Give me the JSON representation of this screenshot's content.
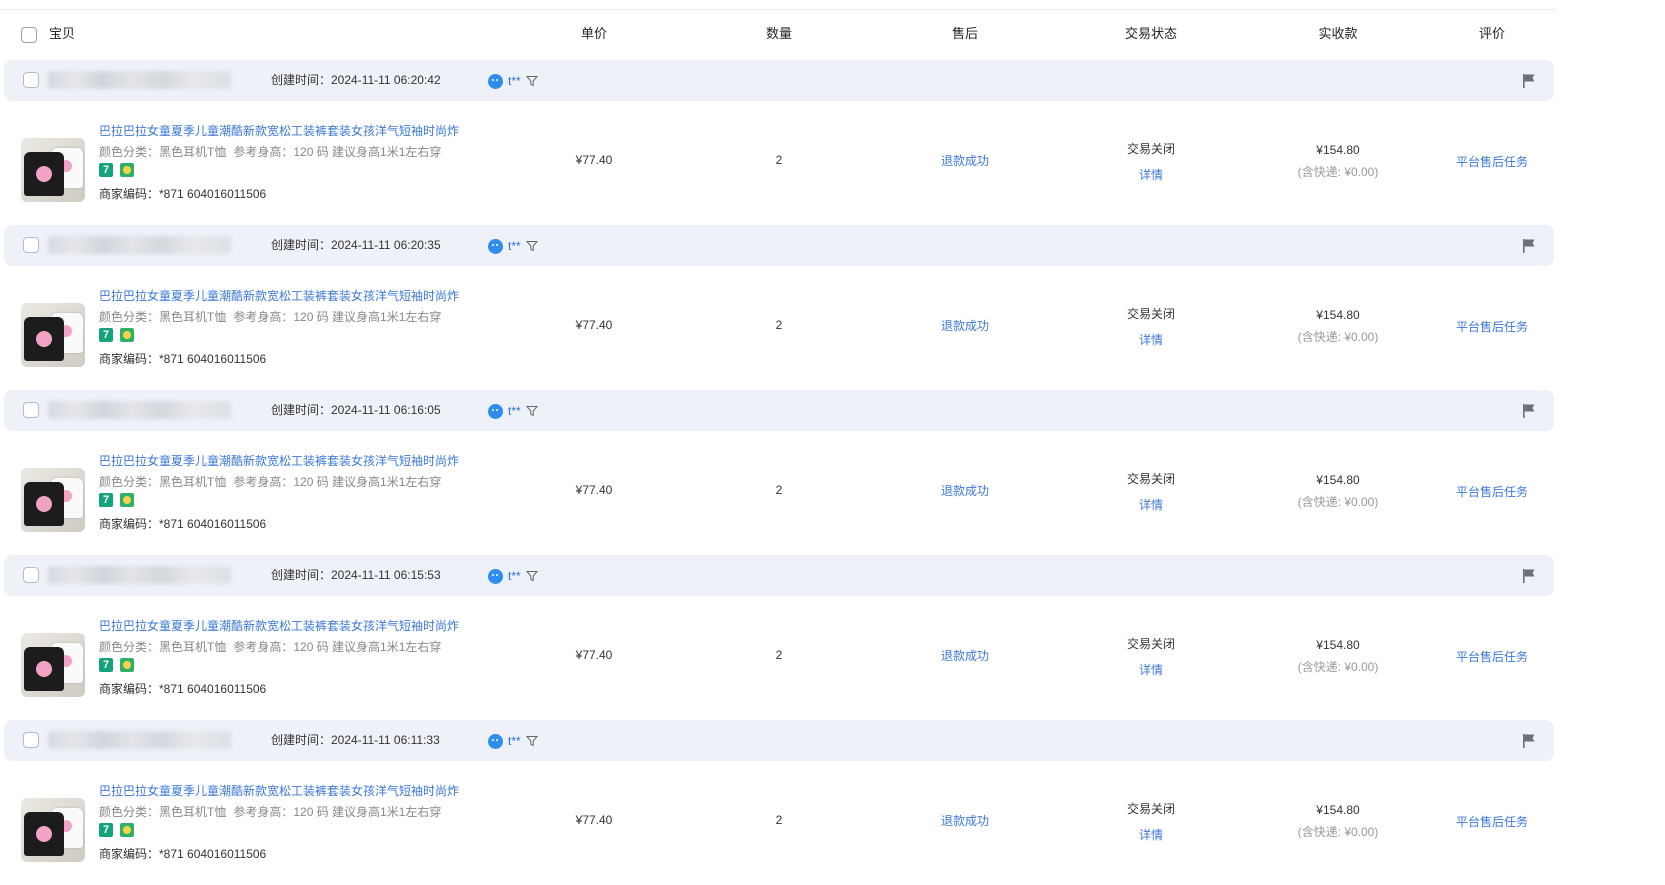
{
  "header": {
    "baobei": "宝贝",
    "price": "单价",
    "qty": "数量",
    "aftersale": "售后",
    "status": "交易状态",
    "amount": "实收款",
    "review": "评价"
  },
  "orders": [
    {
      "created": "创建时间：2024-11-11 06:20:42",
      "buyer": "t**",
      "title": "巴拉巴拉女童夏季儿童潮酷新款宽松工装裤套装女孩洋气短袖时尚炸",
      "spec_color": "颜色分类：黑色耳机T恤",
      "spec_size": "参考身高：120 码 建议身高1米1左右穿",
      "badge_text": "7",
      "code": "商家编码：*871 604016011506",
      "price": "¥77.40",
      "qty": "2",
      "aftersale": "退款成功",
      "status": "交易关闭",
      "detail": "详情",
      "amount": "¥154.80",
      "shipping": "(含快递: ¥0.00)",
      "review": "平台售后任务"
    },
    {
      "created": "创建时间：2024-11-11 06:20:35",
      "buyer": "t**",
      "title": "巴拉巴拉女童夏季儿童潮酷新款宽松工装裤套装女孩洋气短袖时尚炸",
      "spec_color": "颜色分类：黑色耳机T恤",
      "spec_size": "参考身高：120 码 建议身高1米1左右穿",
      "badge_text": "7",
      "code": "商家编码：*871 604016011506",
      "price": "¥77.40",
      "qty": "2",
      "aftersale": "退款成功",
      "status": "交易关闭",
      "detail": "详情",
      "amount": "¥154.80",
      "shipping": "(含快递: ¥0.00)",
      "review": "平台售后任务"
    },
    {
      "created": "创建时间：2024-11-11 06:16:05",
      "buyer": "t**",
      "title": "巴拉巴拉女童夏季儿童潮酷新款宽松工装裤套装女孩洋气短袖时尚炸",
      "spec_color": "颜色分类：黑色耳机T恤",
      "spec_size": "参考身高：120 码 建议身高1米1左右穿",
      "badge_text": "7",
      "code": "商家编码：*871 604016011506",
      "price": "¥77.40",
      "qty": "2",
      "aftersale": "退款成功",
      "status": "交易关闭",
      "detail": "详情",
      "amount": "¥154.80",
      "shipping": "(含快递: ¥0.00)",
      "review": "平台售后任务"
    },
    {
      "created": "创建时间：2024-11-11 06:15:53",
      "buyer": "t**",
      "title": "巴拉巴拉女童夏季儿童潮酷新款宽松工装裤套装女孩洋气短袖时尚炸",
      "spec_color": "颜色分类：黑色耳机T恤",
      "spec_size": "参考身高：120 码 建议身高1米1左右穿",
      "badge_text": "7",
      "code": "商家编码：*871 604016011506",
      "price": "¥77.40",
      "qty": "2",
      "aftersale": "退款成功",
      "status": "交易关闭",
      "detail": "详情",
      "amount": "¥154.80",
      "shipping": "(含快递: ¥0.00)",
      "review": "平台售后任务"
    },
    {
      "created": "创建时间：2024-11-11 06:11:33",
      "buyer": "t**",
      "title": "巴拉巴拉女童夏季儿童潮酷新款宽松工装裤套装女孩洋气短袖时尚炸",
      "spec_color": "颜色分类：黑色耳机T恤",
      "spec_size": "参考身高：120 码 建议身高1米1左右穿",
      "badge_text": "7",
      "code": "商家编码：*871 604016011506",
      "price": "¥77.40",
      "qty": "2",
      "aftersale": "退款成功",
      "status": "交易关闭",
      "detail": "详情",
      "amount": "¥154.80",
      "shipping": "(含快递: ¥0.00)",
      "review": "平台售后任务"
    }
  ]
}
